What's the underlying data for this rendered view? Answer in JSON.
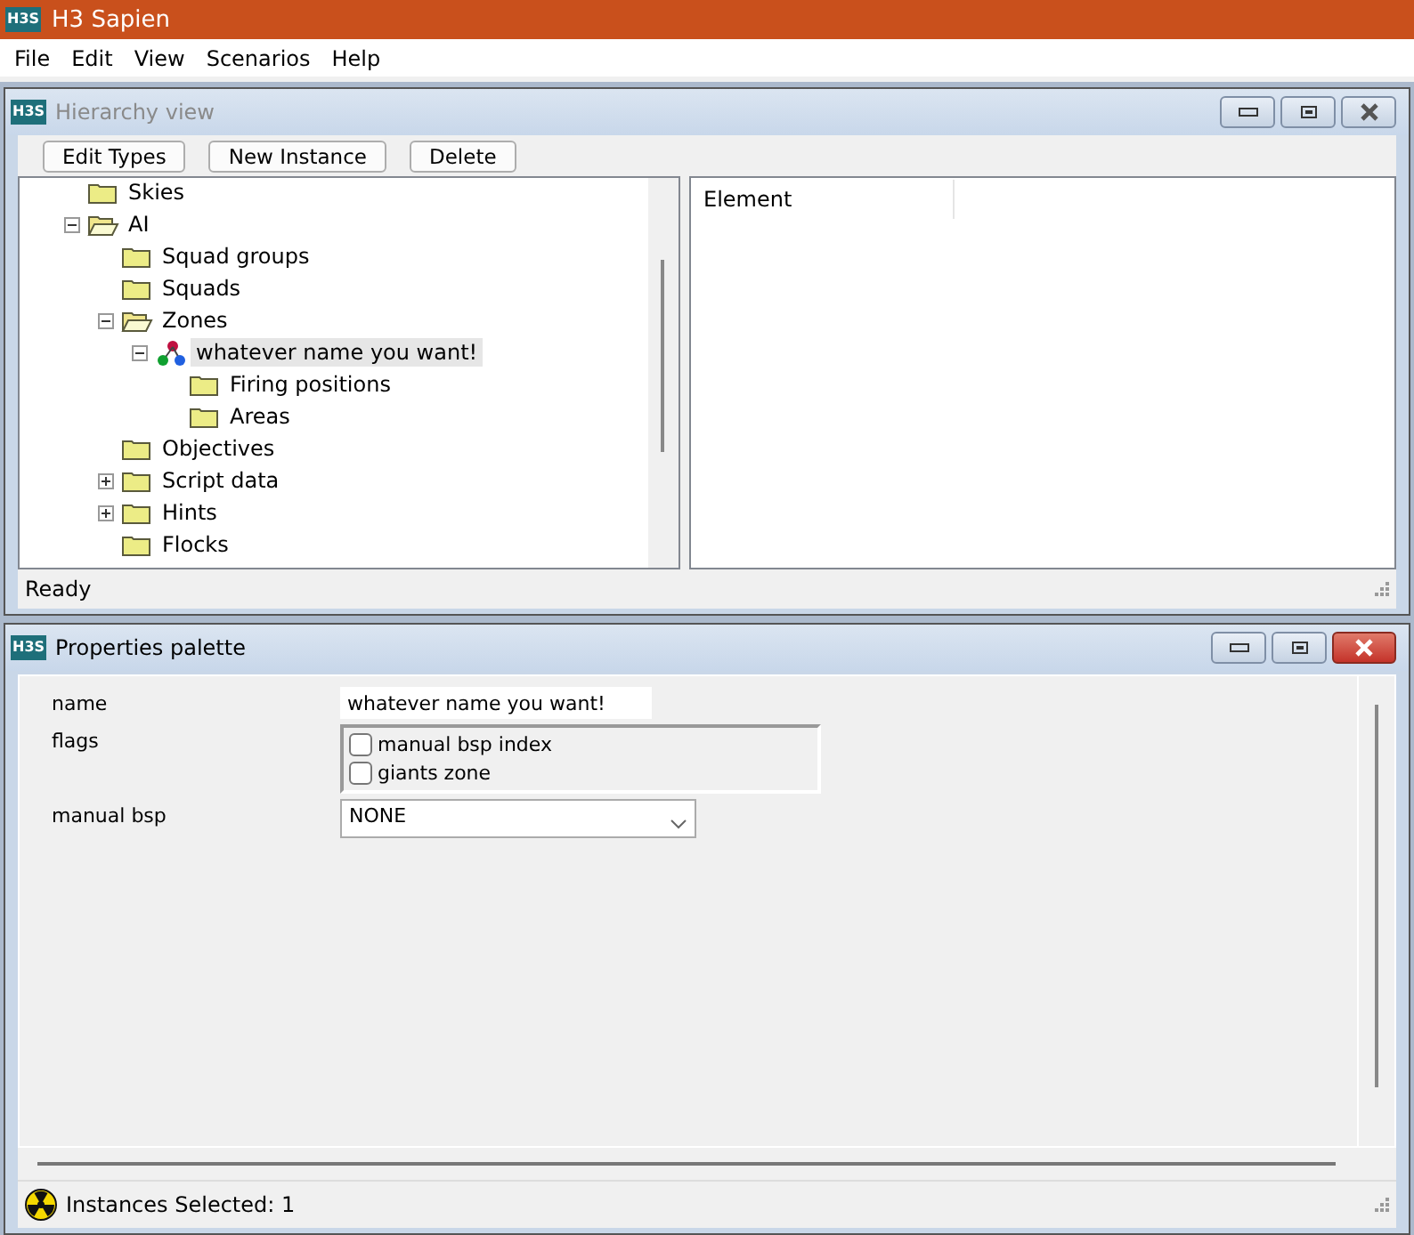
{
  "app": {
    "title": "H3 Sapien",
    "logo": "H3S"
  },
  "menu": [
    "File",
    "Edit",
    "View",
    "Scenarios",
    "Help"
  ],
  "hierarchy_window": {
    "title": "Hierarchy view",
    "logo": "H3S",
    "active": false,
    "toolbar": [
      "Edit Types",
      "New Instance",
      "Delete"
    ],
    "tree": [
      {
        "label": "Skies",
        "kind": "folder",
        "selected": false
      },
      {
        "label": "AI",
        "kind": "folder",
        "selected": false,
        "expanded": true,
        "children": [
          {
            "label": "Squad groups",
            "kind": "folder",
            "selected": false
          },
          {
            "label": "Squads",
            "kind": "folder",
            "selected": false
          },
          {
            "label": "Zones",
            "kind": "folder",
            "selected": false,
            "expanded": true,
            "children": [
              {
                "label": "whatever name you want!",
                "kind": "zone",
                "selected": true,
                "expanded": true,
                "children": [
                  {
                    "label": "Firing positions",
                    "kind": "folder",
                    "selected": false
                  },
                  {
                    "label": "Areas",
                    "kind": "folder",
                    "selected": false
                  }
                ]
              }
            ]
          },
          {
            "label": "Objectives",
            "kind": "folder",
            "selected": false
          },
          {
            "label": "Script data",
            "kind": "folder",
            "selected": false,
            "expanded": false
          },
          {
            "label": "Hints",
            "kind": "folder",
            "selected": false,
            "expanded": false
          },
          {
            "label": "Flocks",
            "kind": "folder",
            "selected": false
          }
        ]
      }
    ],
    "list_columns": [
      "Element"
    ],
    "status": "Ready"
  },
  "properties_window": {
    "title": "Properties palette",
    "logo": "H3S",
    "active": true,
    "fields": [
      {
        "kind": "text",
        "label": "name",
        "value": "whatever name you want!"
      },
      {
        "kind": "flags",
        "label": "flags",
        "options": [
          {
            "label": "manual bsp index",
            "checked": false
          },
          {
            "label": "giants zone",
            "checked": false
          }
        ]
      },
      {
        "kind": "dropdown",
        "label": "manual bsp",
        "value": "NONE"
      }
    ],
    "status": "Instances Selected: 1"
  }
}
